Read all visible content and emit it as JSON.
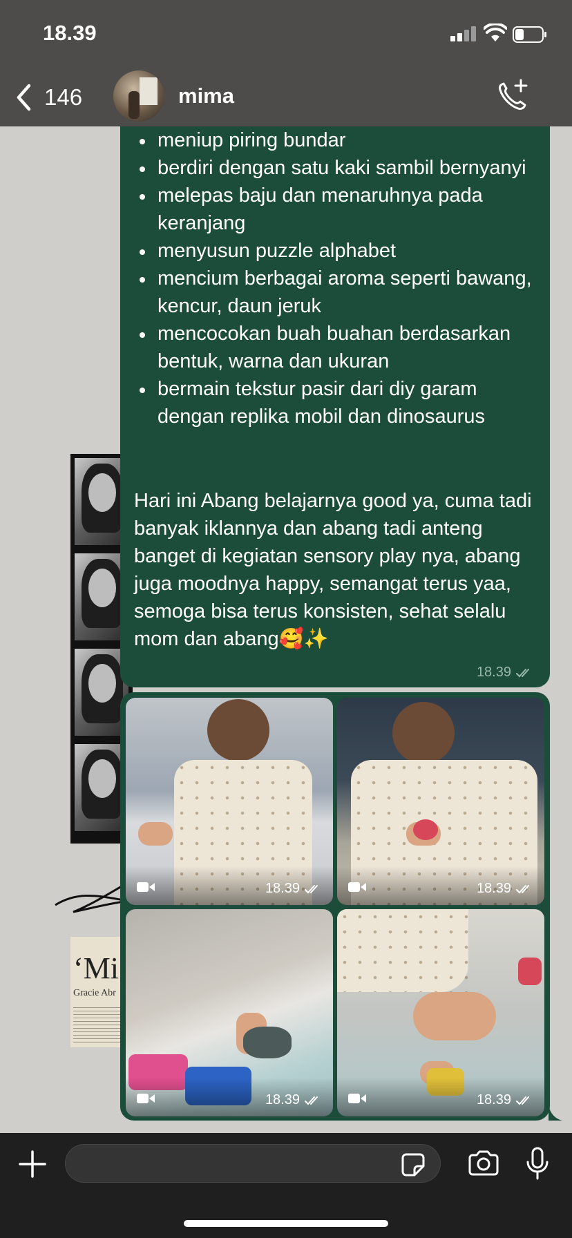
{
  "status_bar": {
    "time": "18.39"
  },
  "header": {
    "back_count": "146",
    "contact_name": "mima"
  },
  "message": {
    "bullets": [
      "meniup piring bundar",
      "berdiri dengan satu kaki sambil bernyanyi",
      "melepas baju dan menaruhnya pada keranjang",
      "menyusun puzzle alphabet",
      "mencium berbagai aroma seperti bawang, kencur, daun jeruk",
      "mencocokan buah buahan berdasarkan bentuk, warna dan ukuran",
      "bermain tekstur pasir dari diy garam dengan replika mobil dan dinosaurus"
    ],
    "paragraph": "Hari ini Abang belajarnya good ya, cuma tadi banyak iklannya dan abang tadi anteng banget di kegiatan sensory play nya, abang juga moodnya happy, semangat terus yaa, semoga bisa terus konsisten, sehat selalu mom dan abang🥰✨",
    "time": "18.39"
  },
  "media": [
    {
      "type": "video",
      "time": "18.39"
    },
    {
      "type": "video",
      "time": "18.39"
    },
    {
      "type": "video",
      "time": "18.39"
    },
    {
      "type": "video",
      "time": "18.39"
    }
  ],
  "wallpaper": {
    "clipping_big": "‘Mi",
    "clipping_small": "Gracie Abr"
  },
  "composer": {
    "placeholder": ""
  },
  "colors": {
    "bubble": "#1c4d3b",
    "header": "#4d4c4a",
    "input_bar": "#1f1f1f"
  }
}
